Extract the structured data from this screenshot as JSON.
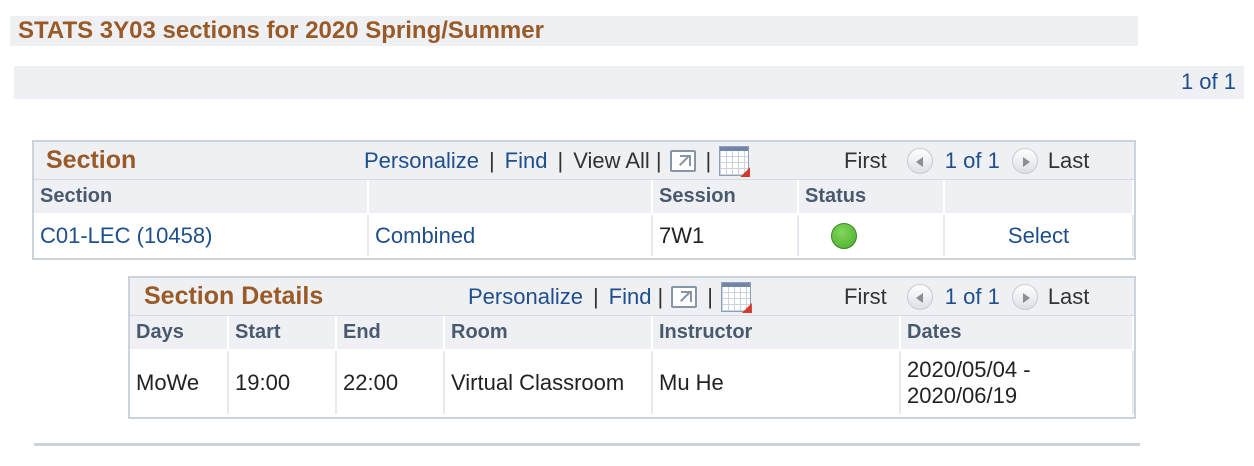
{
  "page": {
    "title": "STATS 3Y03 sections for 2020 Spring/Summer",
    "pager_count": "1 of 1"
  },
  "section_grid": {
    "title": "Section",
    "toolbar": {
      "personalize": "Personalize",
      "find": "Find",
      "view_all": "View All",
      "separator": "|"
    },
    "nav": {
      "first": "First",
      "count": "1 of 1",
      "last": "Last"
    },
    "columns": [
      "Section",
      "",
      "Session",
      "Status",
      ""
    ],
    "rows": [
      {
        "section": "C01-LEC (10458)",
        "type": "Combined",
        "session": "7W1",
        "status": "open",
        "action": "Select"
      }
    ]
  },
  "details_grid": {
    "title": "Section Details",
    "toolbar": {
      "personalize": "Personalize",
      "find": "Find",
      "separator": "|"
    },
    "nav": {
      "first": "First",
      "count": "1 of 1",
      "last": "Last"
    },
    "columns": [
      "Days",
      "Start",
      "End",
      "Room",
      "Instructor",
      "Dates"
    ],
    "rows": [
      {
        "days": "MoWe",
        "start": "19:00",
        "end": "22:00",
        "room": "Virtual Classroom",
        "instructor": "Mu He",
        "dates_line1": "2020/05/04 -",
        "dates_line2": "2020/06/19"
      }
    ]
  },
  "icons": {
    "popout": "popout-icon",
    "download": "download-spreadsheet-icon",
    "prev": "previous-arrow-icon",
    "next": "next-arrow-icon",
    "status": "status-open-icon"
  },
  "colors": {
    "title": "#9a5a28",
    "link": "#1f4e8c",
    "status_open": "#5bb83a"
  }
}
